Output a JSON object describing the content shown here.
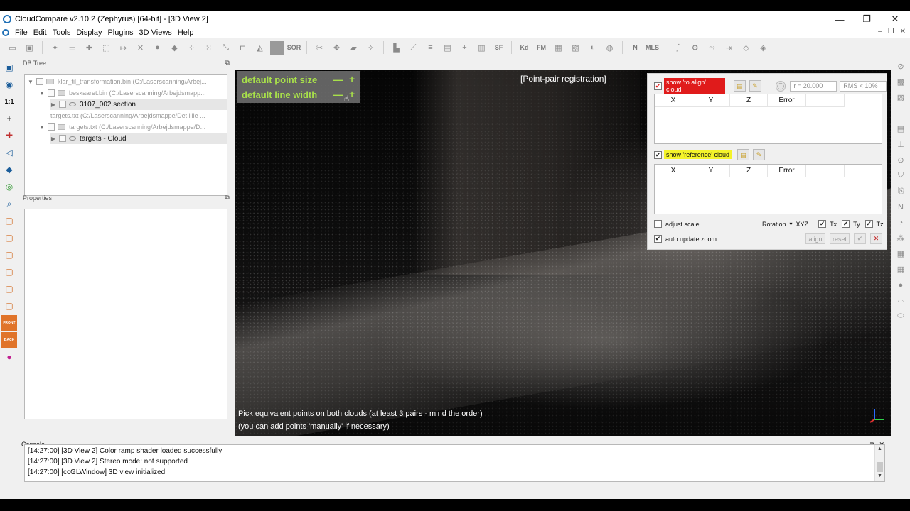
{
  "window": {
    "title": "CloudCompare v2.10.2 (Zephyrus) [64-bit] - [3D View 2]",
    "controls": [
      "—",
      "❐",
      "✕"
    ]
  },
  "menu": {
    "items": [
      "File",
      "Edit",
      "Tools",
      "Display",
      "Plugins",
      "3D Views",
      "Help"
    ],
    "mdi_controls": [
      "–",
      "❐",
      "✕"
    ]
  },
  "toolbar": {
    "sor_label": "SOR",
    "sf_label": "SF",
    "kd_label": "Kd",
    "fm_label": "FM",
    "mls_label": "MLS",
    "nc_label": "N"
  },
  "left_toolbar": {
    "one_to_one": "1:1",
    "front": "FRONT",
    "back": "BACK"
  },
  "dbtree": {
    "header": "DB Tree",
    "rows": [
      {
        "label": "klar_til_transformation.bin (C:/Laserscanning/Arbej...",
        "active": false
      },
      {
        "label": "beskaaret.bin (C:/Laserscanning/Arbejdsmapp...",
        "active": false
      },
      {
        "label": "3107_002.section",
        "active": true
      },
      {
        "label": "targets.txt (C:/Laserscanning/Arbejdsmappe/Det lille ...",
        "active": false
      },
      {
        "label": "targets.txt (C:/Laserscanning/Arbejdsmappe/D...",
        "active": false
      },
      {
        "label": "targets - Cloud",
        "active": true
      }
    ]
  },
  "properties": {
    "header": "Properties"
  },
  "view3d": {
    "title": "[Point-pair registration]",
    "point_size_label": "default point size",
    "line_width_label": "default line width",
    "minus": "—",
    "plus": "+",
    "message_line1": "Pick equivalent points on both clouds (at least 3 pairs - mind the order)",
    "message_line2": "(you can add points 'manually' if necessary)"
  },
  "registration": {
    "show_align_label": "show 'to align' cloud",
    "show_reference_label": "show 'reference' cloud",
    "radius_value": "r = 20.000",
    "rms_value": "RMS < 10%",
    "columns": [
      "X",
      "Y",
      "Z",
      "Error"
    ],
    "adjust_scale_label": "adjust scale",
    "auto_update_zoom_label": "auto update zoom",
    "rotation_label": "Rotation",
    "rotation_value": "XYZ",
    "tx_label": "Tx",
    "ty_label": "Ty",
    "tz_label": "Tz",
    "align_label": "align",
    "reset_label": "reset",
    "colors": {
      "to_align": "#e01b1b",
      "reference": "#f4f32a",
      "overlay_text": "#a8e04a"
    }
  },
  "console": {
    "header": "Console",
    "lines": [
      "[14:27:00] [3D View 2] Color ramp shader loaded successfully",
      "[14:27:00] [3D View 2] Stereo mode: not supported",
      "[14:27:00] [ccGLWindow] 3D view initialized"
    ]
  }
}
